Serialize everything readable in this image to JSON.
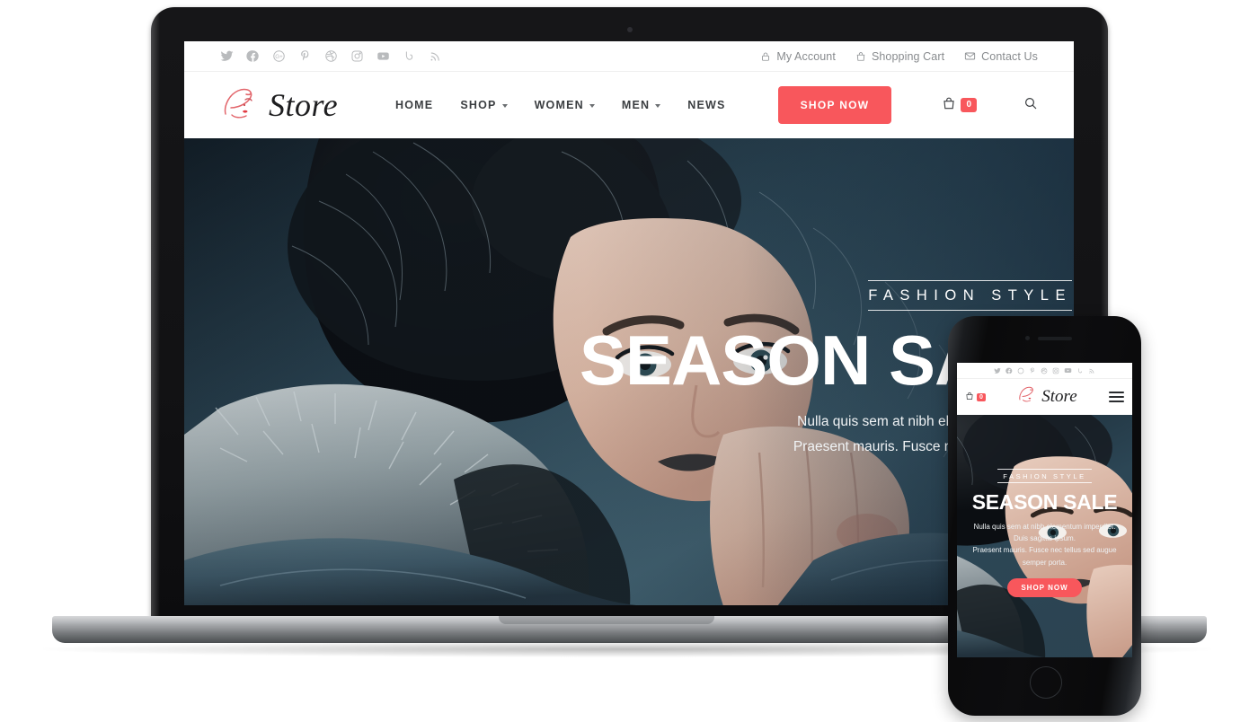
{
  "device_mockup": {
    "laptop_label": "laptop-mockup",
    "phone_label": "phone-mockup"
  },
  "topbar": {
    "social": [
      {
        "name": "twitter-icon",
        "label": "Twitter"
      },
      {
        "name": "facebook-icon",
        "label": "Facebook"
      },
      {
        "name": "google-plus-icon",
        "label": "Google Plus"
      },
      {
        "name": "pinterest-icon",
        "label": "Pinterest"
      },
      {
        "name": "dribbble-icon",
        "label": "Dribbble"
      },
      {
        "name": "instagram-icon",
        "label": "Instagram"
      },
      {
        "name": "youtube-icon",
        "label": "YouTube"
      },
      {
        "name": "vine-icon",
        "label": "Vine"
      },
      {
        "name": "rss-icon",
        "label": "RSS"
      }
    ],
    "links": [
      {
        "icon": "lock-icon",
        "label": "My Account"
      },
      {
        "icon": "shopping-bag-icon",
        "label": "Shopping Cart"
      },
      {
        "icon": "envelope-icon",
        "label": "Contact Us"
      }
    ]
  },
  "header": {
    "logo_text": "Store",
    "logo_icon": "woman-face-logo-icon",
    "nav": [
      {
        "label": "HOME",
        "has_dropdown": false
      },
      {
        "label": "SHOP",
        "has_dropdown": true
      },
      {
        "label": "WOMEN",
        "has_dropdown": true
      },
      {
        "label": "MEN",
        "has_dropdown": true
      },
      {
        "label": "NEWS",
        "has_dropdown": false
      }
    ],
    "cta_label": "SHOP NOW",
    "cart_count": "0",
    "search_icon": "search-icon"
  },
  "hero": {
    "eyebrow": "FASHION STYLE",
    "headline": "SEASON SALE",
    "sub_line1": "Nulla quis sem at nibh elementum imperdiet.",
    "sub_line2": "Praesent mauris. Fusce nec tellus sed augue"
  },
  "phone": {
    "logo_text": "Store",
    "cart_count": "0",
    "eyebrow": "FASHION STYLE",
    "headline": "SEASON SALE",
    "sub_line1": "Nulla quis sem at nibh elementum imperdiet.",
    "sub_line2": "Duis sagittis ipsum.",
    "sub_line3": "Praesent mauris. Fusce nec tellus sed augue",
    "sub_line4": "semper porta.",
    "cta_label": "SHOP NOW"
  },
  "colors": {
    "accent": "#f8575c",
    "text_dark": "#3a3d40",
    "muted": "#888b8e",
    "hero_bg": "#17252f"
  }
}
